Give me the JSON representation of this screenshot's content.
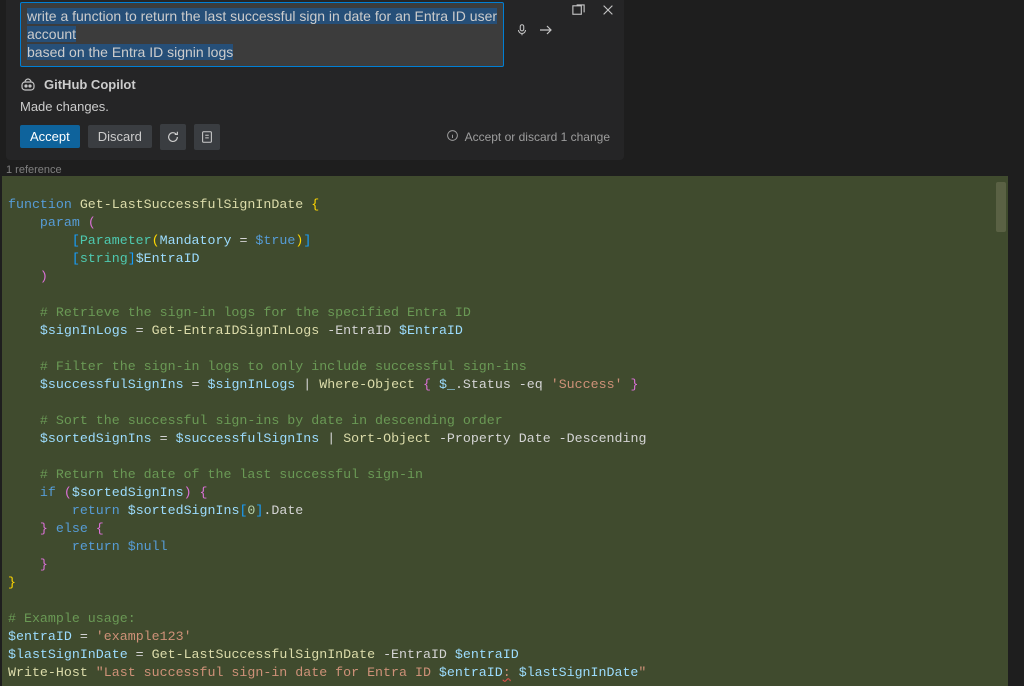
{
  "prompt": {
    "line1": "write a function to return the last successful sign in date for an Entra ID user account",
    "line2": "based on the Entra ID signin logs"
  },
  "copilot": {
    "title": "GitHub Copilot",
    "status": "Made changes.",
    "accept": "Accept",
    "discard": "Discard",
    "hint": "Accept or discard 1 change"
  },
  "reference": "1 reference",
  "code": {
    "l1_kw": "function",
    "l1_fn": "Get-LastSuccessfulSignInDate",
    "l2_kw": "param",
    "l3_attr_open": "[",
    "l3_type": "Parameter",
    "l3_mand": "Mandatory",
    "l3_true": "$true",
    "l4_type": "string",
    "l4_var": "$EntraID",
    "c1": "# Retrieve the sign-in logs for the specified Entra ID",
    "l6_var": "$signInLogs",
    "l6_fn": "Get-EntraIDSignInLogs",
    "l6_p1": "-EntraID",
    "l6_v1": "$EntraID",
    "c2": "# Filter the sign-in logs to only include successful sign-ins",
    "l8_var": "$successfulSignIns",
    "l8_src": "$signInLogs",
    "l8_fn": "Where-Object",
    "l8_it": "$_",
    "l8_prop": ".Status",
    "l8_op": "-eq",
    "l8_str": "'Success'",
    "c3": "# Sort the successful sign-ins by date in descending order",
    "l10_var": "$sortedSignIns",
    "l10_src": "$successfulSignIns",
    "l10_fn": "Sort-Object",
    "l10_p1": "-Property",
    "l10_v1": "Date",
    "l10_p2": "-Descending",
    "c4": "# Return the date of the last successful sign-in",
    "l12_kw": "if",
    "l12_var": "$sortedSignIns",
    "l13_kw": "return",
    "l13_var": "$sortedSignIns",
    "l13_idx": "0",
    "l13_prop": ".Date",
    "l14_kw": "else",
    "l15_kw": "return",
    "l15_var": "$null",
    "c5": "# Example usage:",
    "l18_var": "$entraID",
    "l18_str": "'example123'",
    "l19_var": "$lastSignInDate",
    "l19_fn": "Get-LastSuccessfulSignInDate",
    "l19_p": "-EntraID",
    "l19_v": "$entraID",
    "l20_fn": "Write-Host",
    "l20_str1": "\"Last successful sign-in date for Entra ID ",
    "l20_v1": "$entraID",
    "l20_col": ":",
    "l20_v2": "$lastSignInDate",
    "l20_q": "\""
  }
}
